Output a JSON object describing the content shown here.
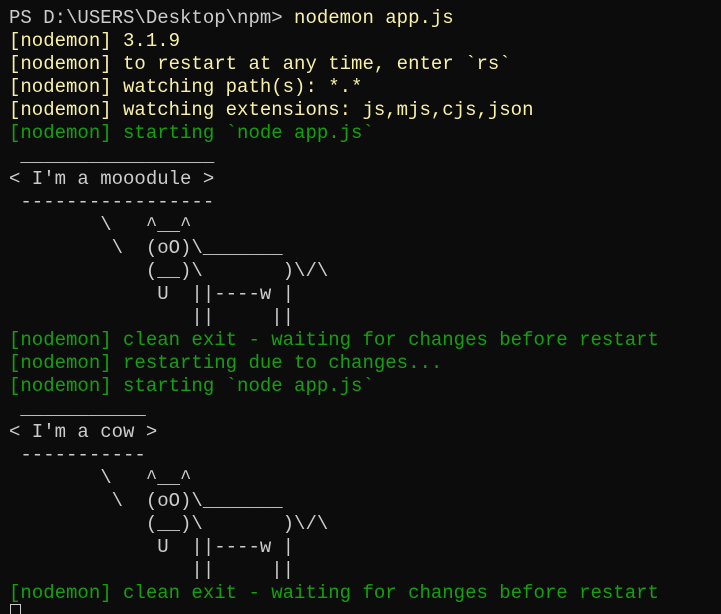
{
  "prompt": {
    "ps_path": "PS D:\\USERS\\Desktop\\npm> ",
    "command": "nodemon app.js"
  },
  "lines": [
    {
      "text": "[nodemon] 3.1.9",
      "color": "yellow"
    },
    {
      "text": "[nodemon] to restart at any time, enter `rs`",
      "color": "yellow"
    },
    {
      "text": "[nodemon] watching path(s): *.*",
      "color": "yellow"
    },
    {
      "text": "[nodemon] watching extensions: js,mjs,cjs,json",
      "color": "yellow"
    },
    {
      "text": "[nodemon] starting `node app.js`",
      "color": "green"
    },
    {
      "text": " _________________",
      "color": "plain"
    },
    {
      "text": "< I'm a mooodule >",
      "color": "plain"
    },
    {
      "text": " -----------------",
      "color": "plain"
    },
    {
      "text": "        \\   ^__^",
      "color": "plain"
    },
    {
      "text": "         \\  (oO)\\_______",
      "color": "plain"
    },
    {
      "text": "            (__)\\       )\\/\\",
      "color": "plain"
    },
    {
      "text": "             U  ||----w |",
      "color": "plain"
    },
    {
      "text": "                ||     ||",
      "color": "plain"
    },
    {
      "text": "[nodemon] clean exit - waiting for changes before restart",
      "color": "green"
    },
    {
      "text": "[nodemon] restarting due to changes...",
      "color": "green"
    },
    {
      "text": "[nodemon] starting `node app.js`",
      "color": "green"
    },
    {
      "text": " ___________",
      "color": "plain"
    },
    {
      "text": "< I'm a cow >",
      "color": "plain"
    },
    {
      "text": " -----------",
      "color": "plain"
    },
    {
      "text": "        \\   ^__^",
      "color": "plain"
    },
    {
      "text": "         \\  (oO)\\_______",
      "color": "plain"
    },
    {
      "text": "            (__)\\       )\\/\\",
      "color": "plain"
    },
    {
      "text": "             U  ||----w |",
      "color": "plain"
    },
    {
      "text": "                ||     ||",
      "color": "plain"
    },
    {
      "text": "[nodemon] clean exit - waiting for changes before restart",
      "color": "green"
    }
  ],
  "colors": {
    "background": "#0c0c0c",
    "plain": "#cccccc",
    "yellow": "#f9f1a5",
    "green": "#13a10e"
  }
}
